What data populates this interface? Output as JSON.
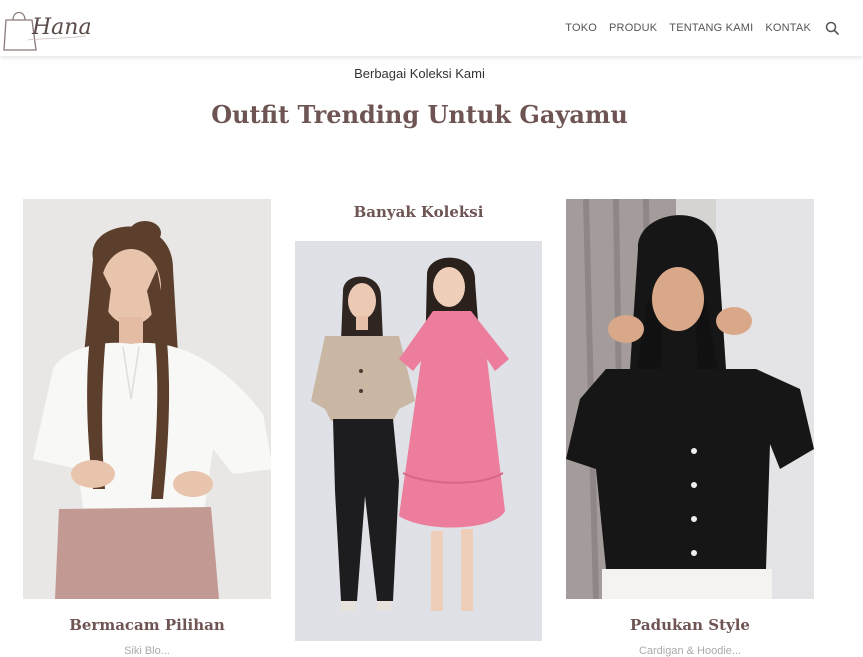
{
  "brand": {
    "logo_text": "Hana"
  },
  "nav": {
    "items": [
      "TOKO",
      "PRODUK",
      "TENTANG KAMI",
      "KONTAK"
    ],
    "search_icon": "search-icon"
  },
  "section": {
    "subtitle": "Berbagai Koleksi Kami",
    "headline": "Outfit Trending Untuk Gayamu"
  },
  "cards": [
    {
      "title": "Bermacam Pilihan",
      "desc": "Siki Blo...",
      "image": "woman-white-blouse-pink-skirt-photo"
    },
    {
      "title": "Banyak Koleksi",
      "desc": "",
      "image": "two-women-beige-top-pink-dress-photo"
    },
    {
      "title": "Padukan Style",
      "desc": "Cardigan & Hoodie...",
      "image": "woman-black-hooded-cardigan-photo"
    }
  ],
  "colors": {
    "accent": "#6e5553",
    "nav_text": "#555555",
    "muted": "#aaaaaa"
  }
}
